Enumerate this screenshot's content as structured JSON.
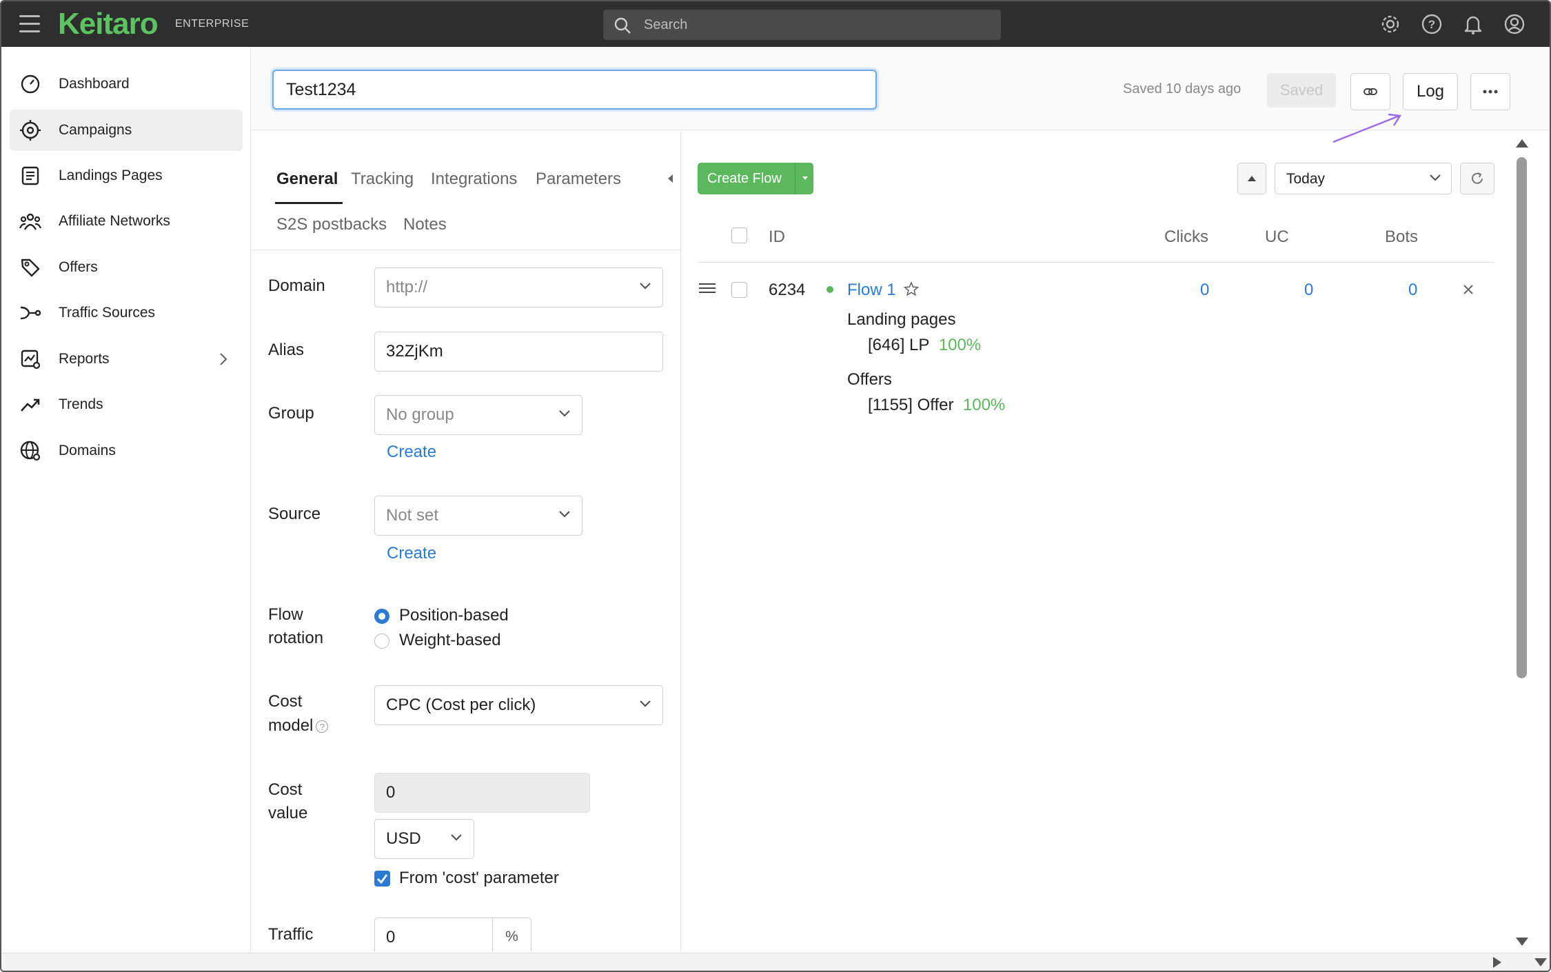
{
  "topbar": {
    "logo": "Keitaro",
    "edition": "ENTERPRISE",
    "search_placeholder": "Search",
    "icons": [
      "settings-icon",
      "help-icon",
      "bell-icon",
      "account-icon"
    ]
  },
  "sidebar": {
    "items": [
      {
        "label": "Dashboard",
        "icon": "dashboard-icon"
      },
      {
        "label": "Campaigns",
        "icon": "target-icon",
        "active": true
      },
      {
        "label": "Landings Pages",
        "icon": "landing-page-icon"
      },
      {
        "label": "Affiliate Networks",
        "icon": "network-icon"
      },
      {
        "label": "Offers",
        "icon": "tag-icon"
      },
      {
        "label": "Traffic Sources",
        "icon": "traffic-source-icon"
      },
      {
        "label": "Reports",
        "icon": "reports-icon",
        "has_children": true
      },
      {
        "label": "Trends",
        "icon": "trend-icon"
      },
      {
        "label": "Domains",
        "icon": "globe-icon"
      }
    ]
  },
  "header": {
    "campaign_name": "Test1234",
    "saved_ago": "Saved 10 days ago",
    "saved_button": "Saved",
    "log_button": "Log"
  },
  "tabs": [
    {
      "label": "General",
      "active": true
    },
    {
      "label": "Tracking"
    },
    {
      "label": "Integrations"
    },
    {
      "label": "Parameters"
    },
    {
      "label": "S2S postbacks"
    },
    {
      "label": "Notes"
    }
  ],
  "form": {
    "domain_label": "Domain",
    "domain_value": "http://",
    "alias_label": "Alias",
    "alias_value": "32ZjKm",
    "group_label": "Group",
    "group_value": "No group",
    "create_link": "Create",
    "source_label": "Source",
    "source_value": "Not set",
    "rotation_label_1": "Flow",
    "rotation_label_2": "rotation",
    "rotation_options": [
      "Position-based",
      "Weight-based"
    ],
    "rotation_selected": "Position-based",
    "cost_model_label_1": "Cost",
    "cost_model_label_2": "model",
    "cost_model_value": "CPC (Cost per click)",
    "cost_value_label_1": "Cost",
    "cost_value_label_2": "value",
    "cost_value": "0",
    "currency": "USD",
    "from_cost_param": "From 'cost' parameter",
    "traffic_label": "Traffic",
    "traffic_value": "0",
    "traffic_unit": "%"
  },
  "flows": {
    "create_button": "Create Flow",
    "period": "Today",
    "columns": [
      "ID",
      "Clicks",
      "UC",
      "Bots"
    ],
    "rows": [
      {
        "id": "6234",
        "name": "Flow 1",
        "clicks": "0",
        "uc": "0",
        "bots": "0",
        "landings_title": "Landing pages",
        "landing": "[646] LP",
        "landing_share": "100%",
        "offers_title": "Offers",
        "offer": "[1155] Offer",
        "offer_share": "100%"
      }
    ]
  },
  "colors": {
    "topbar": "#2e2e2e",
    "brand": "#5cc361",
    "link": "#2a7bd3",
    "create_button": "#5cb85c",
    "annotation_arrow": "#9b6ae8"
  }
}
